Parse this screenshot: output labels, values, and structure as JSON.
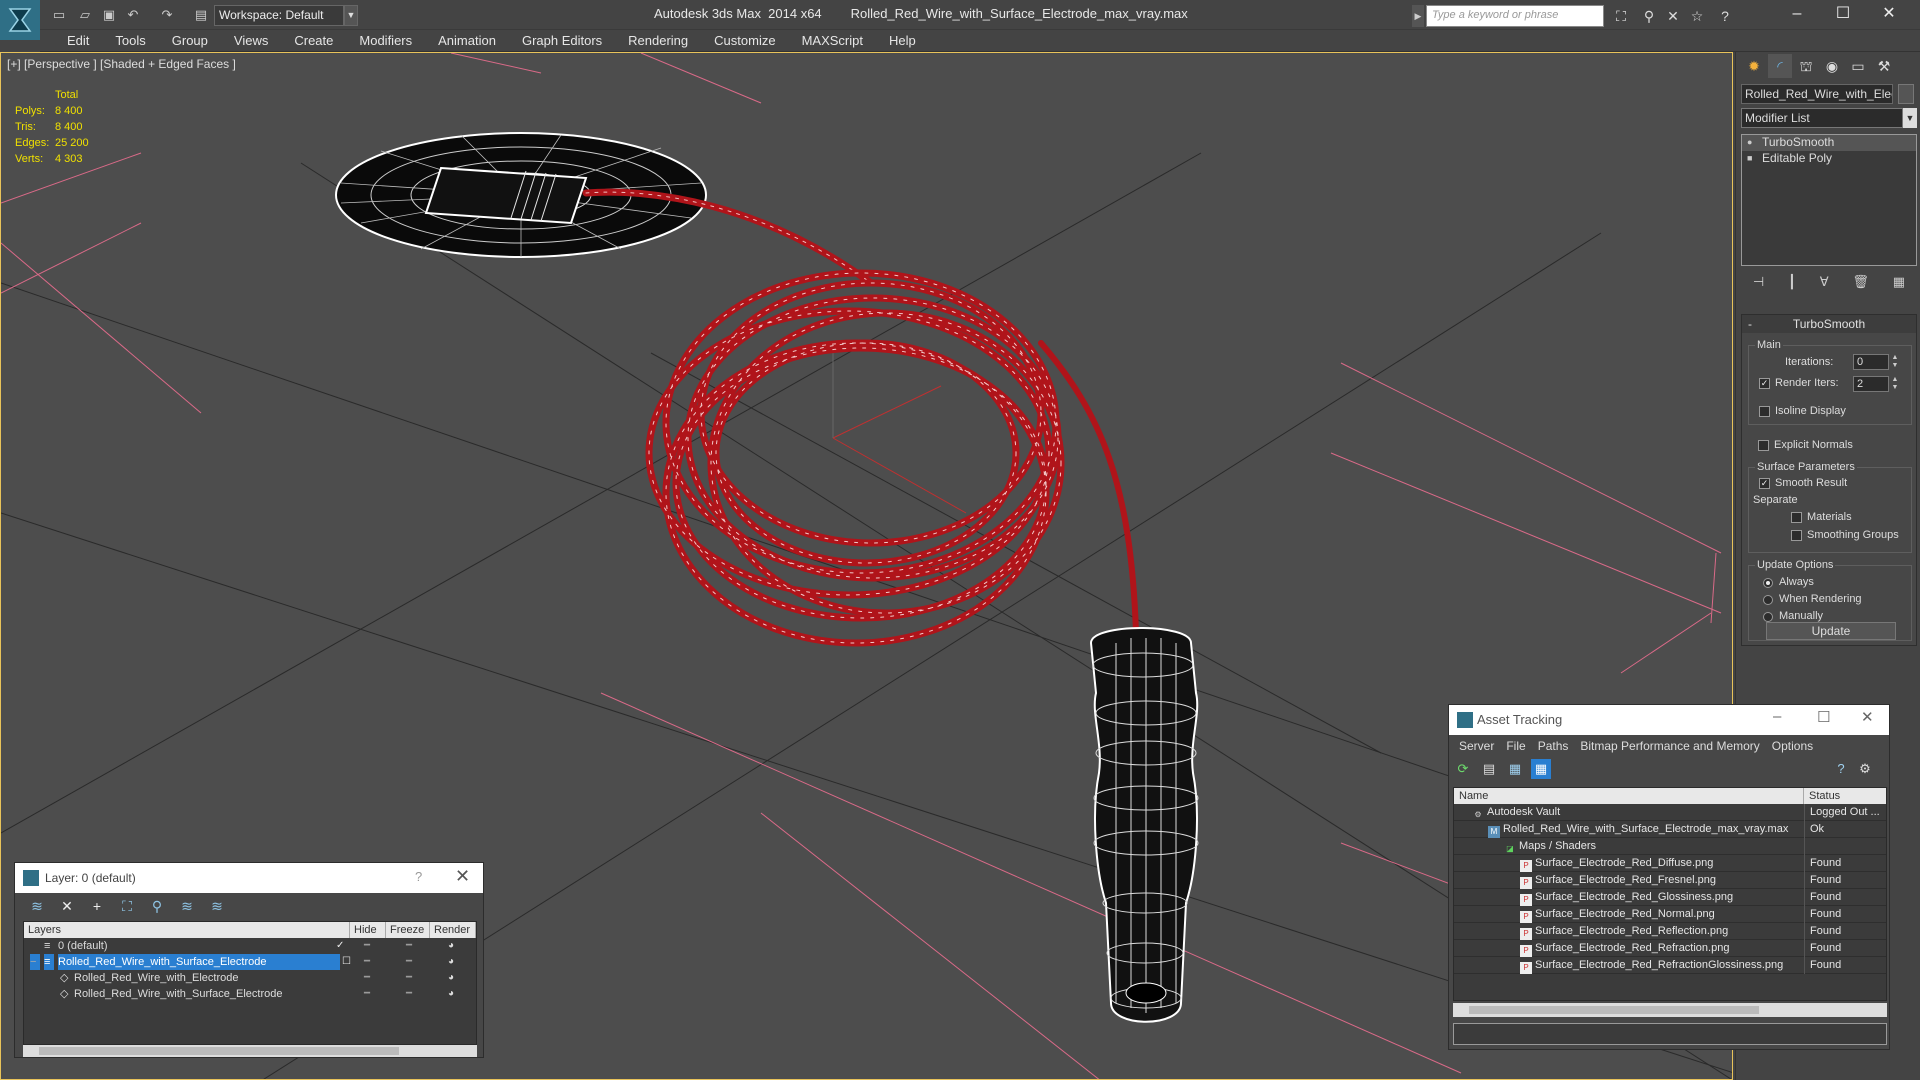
{
  "titlebar": {
    "workspace": "Workspace: Default",
    "app_name": "Autodesk 3ds Max  2014 x64",
    "file_name": "Rolled_Red_Wire_with_Surface_Electrode_max_vray.max",
    "search_placeholder": "Type a keyword or phrase"
  },
  "menu": [
    "Edit",
    "Tools",
    "Group",
    "Views",
    "Create",
    "Modifiers",
    "Animation",
    "Graph Editors",
    "Rendering",
    "Customize",
    "MAXScript",
    "Help"
  ],
  "viewport": {
    "label": "[+] [Perspective ] [Shaded + Edged Faces ]",
    "stats_header": "Total",
    "stats": [
      {
        "label": "Polys:",
        "value": "8 400"
      },
      {
        "label": "Tris:",
        "value": "8 400"
      },
      {
        "label": "Edges:",
        "value": "25 200"
      },
      {
        "label": "Verts:",
        "value": "4 303"
      }
    ]
  },
  "command_panel": {
    "object_name": "Rolled_Red_Wire_with_Electr",
    "modifier_list": "Modifier List",
    "stack": [
      "TurboSmooth",
      "Editable Poly"
    ],
    "rollout_title": "TurboSmooth",
    "main_group": "Main",
    "iterations_label": "Iterations:",
    "iterations_value": "0",
    "render_iters_label": "Render Iters:",
    "render_iters_value": "2",
    "isoline": "Isoline Display",
    "explicit_normals": "Explicit Normals",
    "surface_params": "Surface Parameters",
    "smooth_result": "Smooth Result",
    "separate": "Separate",
    "materials": "Materials",
    "smoothing_groups": "Smoothing Groups",
    "update_options": "Update Options",
    "always": "Always",
    "when_rendering": "When Rendering",
    "manually": "Manually",
    "update_button": "Update"
  },
  "layer_panel": {
    "title": "Layer: 0 (default)",
    "help": "?",
    "columns": [
      "Layers",
      "Hide",
      "Freeze",
      "Render"
    ],
    "rows": [
      {
        "name": "0 (default)",
        "indent": 0
      },
      {
        "name": "Rolled_Red_Wire_with_Surface_Electrode",
        "indent": 0
      },
      {
        "name": "Rolled_Red_Wire_with_Electrode",
        "indent": 1
      },
      {
        "name": "Rolled_Red_Wire_with_Surface_Electrode",
        "indent": 1
      }
    ]
  },
  "asset_panel": {
    "title": "Asset Tracking",
    "menu": [
      "Server",
      "File",
      "Paths",
      "Bitmap Performance and Memory",
      "Options"
    ],
    "columns": [
      "Name",
      "Status"
    ],
    "rows": [
      {
        "name": "Autodesk Vault",
        "status": "Logged Out ...",
        "indent": 0,
        "icon": "vault-icon"
      },
      {
        "name": "Rolled_Red_Wire_with_Surface_Electrode_max_vray.max",
        "status": "Ok",
        "indent": 1,
        "icon": "max-file-icon"
      },
      {
        "name": "Maps / Shaders",
        "status": "",
        "indent": 2,
        "icon": "maps-folder-icon"
      },
      {
        "name": "Surface_Electrode_Red_Diffuse.png",
        "status": "Found",
        "indent": 3,
        "icon": "png-icon"
      },
      {
        "name": "Surface_Electrode_Red_Fresnel.png",
        "status": "Found",
        "indent": 3,
        "icon": "png-icon"
      },
      {
        "name": "Surface_Electrode_Red_Glossiness.png",
        "status": "Found",
        "indent": 3,
        "icon": "png-icon"
      },
      {
        "name": "Surface_Electrode_Red_Normal.png",
        "status": "Found",
        "indent": 3,
        "icon": "png-icon"
      },
      {
        "name": "Surface_Electrode_Red_Reflection.png",
        "status": "Found",
        "indent": 3,
        "icon": "png-icon"
      },
      {
        "name": "Surface_Electrode_Red_Refraction.png",
        "status": "Found",
        "indent": 3,
        "icon": "png-icon"
      },
      {
        "name": "Surface_Electrode_Red_RefractionGlossiness.png",
        "status": "Found",
        "indent": 3,
        "icon": "png-icon"
      }
    ]
  },
  "colors": {
    "accent_selection": "#2a7fd1",
    "wire_red": "#b0141a",
    "stats_yellow": "#f0e000"
  }
}
